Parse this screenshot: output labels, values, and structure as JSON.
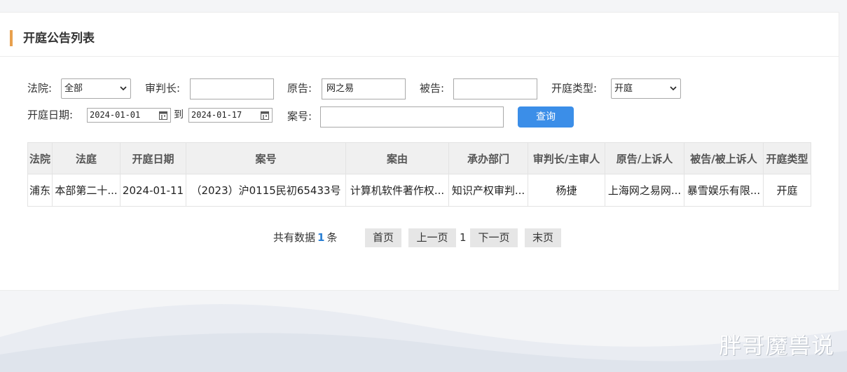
{
  "panel": {
    "title": "开庭公告列表"
  },
  "filters": {
    "court_label": "法院:",
    "court_value": "全部",
    "judge_label": "审判长:",
    "judge_value": "",
    "plaintiff_label": "原告:",
    "plaintiff_value": "网之易",
    "defendant_label": "被告:",
    "defendant_value": "",
    "type_label": "开庭类型:",
    "type_value": "开庭",
    "date_label": "开庭日期:",
    "date_from": "2024-01-01",
    "date_to_label": "到",
    "date_to": "2024-01-17",
    "case_label": "案号:",
    "case_value": "",
    "query_button": "查询"
  },
  "table": {
    "columns": [
      "法院",
      "法庭",
      "开庭日期",
      "案号",
      "案由",
      "承办部门",
      "审判长/主审人",
      "原告/上诉人",
      "被告/被上诉人",
      "开庭类型"
    ],
    "rows": [
      [
        "浦东",
        "本部第二十...",
        "2024-01-11",
        "（2023）沪0115民初65433号",
        "计算机软件著作权...",
        "知识产权审判...",
        "杨捷",
        "上海网之易网...",
        "暴雪娱乐有限...",
        "开庭"
      ]
    ]
  },
  "pager": {
    "total_prefix": "共有数据",
    "total_count": "1",
    "total_suffix": "条",
    "first": "首页",
    "prev": "上一页",
    "current": "1",
    "next": "下一页",
    "last": "末页"
  },
  "watermark": "胖哥魔兽说",
  "colors": {
    "accent": "#e8a04d",
    "primary": "#3b8ee8",
    "count": "#2a7fd4"
  }
}
